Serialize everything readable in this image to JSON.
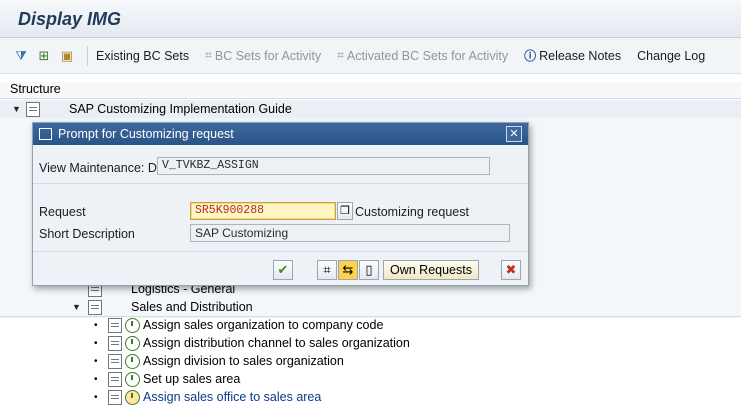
{
  "window": {
    "title": "Display IMG"
  },
  "toolbar": {
    "icons": [
      "expand-icon",
      "find-icon",
      "favorites-icon"
    ],
    "buttons": [
      {
        "label": "Existing BC Sets",
        "enabled": true
      },
      {
        "label": "BC Sets for Activity",
        "enabled": false
      },
      {
        "label": "Activated BC Sets for Activity",
        "enabled": false
      },
      {
        "label": "Release Notes",
        "enabled": true
      },
      {
        "label": "Change Log",
        "enabled": true
      }
    ]
  },
  "structure": {
    "header": "Structure",
    "root": "SAP Customizing Implementation Guide",
    "logistics": "Logistics - General",
    "sales": "Sales and Distribution",
    "items": [
      "Assign sales organization to company code",
      "Assign distribution channel to sales organization",
      "Assign division to sales organization",
      "Set up sales area",
      "Assign sales office to sales area"
    ],
    "highlight_color": "#0a3c8c"
  },
  "dialog": {
    "title": "Prompt for Customizing request",
    "view_label": "View Maintenance: D...",
    "view_value": "V_TVKBZ_ASSIGN",
    "request_label": "Request",
    "request_value": "SR5K900288",
    "request_type": "Customizing request",
    "short_desc_label": "Short Description",
    "short_desc_value": "SAP Customizing",
    "own_requests_label": "Own Requests"
  },
  "colors": {
    "dialog_title": "#2a5387",
    "required_field": "#fff6c2",
    "request_text": "#b03020"
  }
}
